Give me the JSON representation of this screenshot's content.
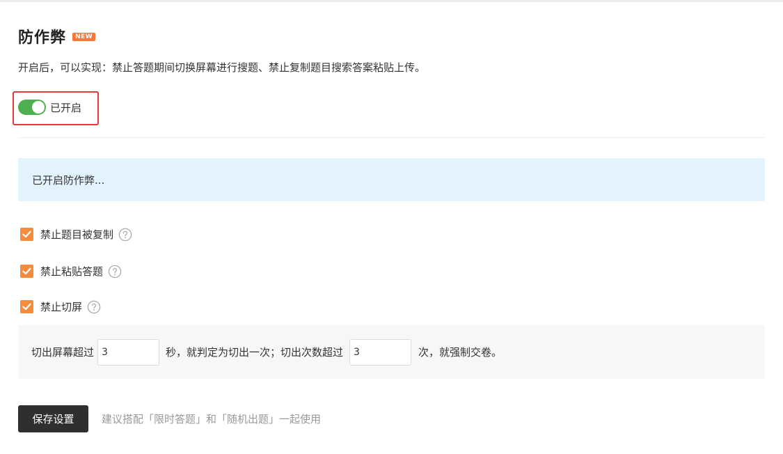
{
  "header": {
    "title": "防作弊",
    "badge": "NEW",
    "description": "开启后，可以实现：禁止答题期间切换屏幕进行搜题、禁止复制题目搜索答案粘贴上传。"
  },
  "toggle": {
    "label": "已开启",
    "state": "on",
    "color": "#4caf50"
  },
  "info": {
    "text": "已开启防作弊..."
  },
  "options": [
    {
      "label": "禁止题目被复制",
      "checked": true,
      "icon": "question-circle-icon"
    },
    {
      "label": "禁止粘贴答题",
      "checked": true,
      "icon": "question-circle-icon"
    },
    {
      "label": "禁止切屏",
      "checked": true,
      "icon": "question-circle-icon"
    }
  ],
  "switch_settings": {
    "prefix": "切出屏幕超过",
    "seconds_value": "3",
    "middle": "秒，就判定为切出一次；切出次数超过",
    "count_value": "3",
    "suffix": "次，就强制交卷。"
  },
  "footer": {
    "save_label": "保存设置",
    "hint": "建议搭配「限时答题」和「随机出题」一起使用"
  },
  "colors": {
    "accent": "#f58b3c",
    "badge": "#f5773b",
    "highlight_border": "#e53935",
    "info_bg": "#e3f3fd"
  }
}
